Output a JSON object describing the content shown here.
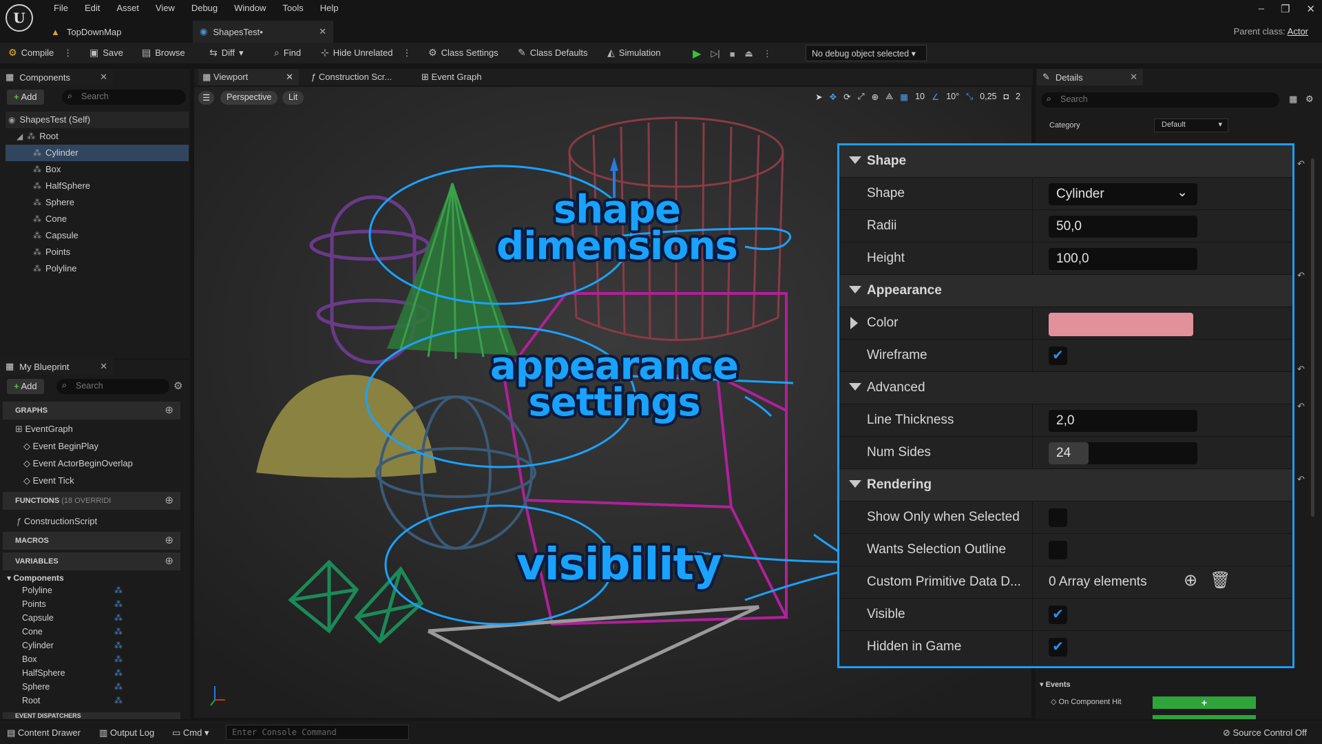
{
  "app": {
    "logo": "U"
  },
  "menu": [
    "File",
    "Edit",
    "Asset",
    "View",
    "Debug",
    "Window",
    "Tools",
    "Help"
  ],
  "window_controls": [
    "–",
    "❐",
    "✕"
  ],
  "tabs": [
    {
      "label": "TopDownMap"
    },
    {
      "label": "ShapesTest•"
    }
  ],
  "parent_class": {
    "label": "Parent class:",
    "value": "Actor"
  },
  "toolbar": {
    "compile": "Compile",
    "save": "Save",
    "browse": "Browse",
    "diff": "Diff",
    "find": "Find",
    "hide_unrelated": "Hide Unrelated",
    "class_settings": "Class Settings",
    "class_defaults": "Class Defaults",
    "simulation": "Simulation",
    "debug_object": "No debug object selected"
  },
  "components_panel": {
    "title": "Components",
    "add": "Add",
    "search_placeholder": "Search",
    "items": [
      {
        "label": "ShapesTest (Self)"
      },
      {
        "label": "Root"
      },
      {
        "label": "Cylinder"
      },
      {
        "label": "Box"
      },
      {
        "label": "HalfSphere"
      },
      {
        "label": "Sphere"
      },
      {
        "label": "Cone"
      },
      {
        "label": "Capsule"
      },
      {
        "label": "Points"
      },
      {
        "label": "Polyline"
      }
    ],
    "selected": "Cylinder"
  },
  "blueprint_panel": {
    "title": "My Blueprint",
    "add": "Add",
    "search_placeholder": "Search",
    "graphs": "GRAPHS",
    "event_graph": "EventGraph",
    "events": [
      "Event BeginPlay",
      "Event ActorBeginOverlap",
      "Event Tick"
    ],
    "functions": "FUNCTIONS",
    "functions_note": "(18 OVERRIDI",
    "construction_script": "ConstructionScript",
    "macros": "MACROS",
    "variables": "VARIABLES",
    "components_group": "Components",
    "variables_list": [
      "Polyline",
      "Points",
      "Capsule",
      "Cone",
      "Cylinder",
      "Box",
      "HalfSphere",
      "Sphere",
      "Root"
    ],
    "event_dispatchers": "EVENT DISPATCHERS"
  },
  "viewport_tabs": [
    {
      "label": "Viewport"
    },
    {
      "label": "Construction Scr..."
    },
    {
      "label": "Event Graph"
    }
  ],
  "viewport": {
    "perspective": "Perspective",
    "lit": "Lit",
    "grid_snap": "10",
    "rot_snap": "10°",
    "scale_snap": "0,25",
    "cam_speed": "2"
  },
  "details": {
    "title": "Details",
    "search_placeholder": "Search",
    "category_label": "Category",
    "category_value": "Default",
    "events_label": "Events",
    "on_component_hit": "On Component Hit",
    "add_glyph": "+"
  },
  "overlay": {
    "shape_header": "Shape",
    "shape_label": "Shape",
    "shape_value": "Cylinder",
    "radii_label": "Radii",
    "radii_value": "50,0",
    "height_label": "Height",
    "height_value": "100,0",
    "appearance_header": "Appearance",
    "color_label": "Color",
    "color_value": "#e2919b",
    "wireframe_label": "Wireframe",
    "wireframe": true,
    "advanced_header": "Advanced",
    "line_thickness_label": "Line Thickness",
    "line_thickness_value": "2,0",
    "num_sides_label": "Num Sides",
    "num_sides_value": "24",
    "rendering_header": "Rendering",
    "show_only_selected_label": "Show Only when Selected",
    "show_only_selected": false,
    "wants_outline_label": "Wants Selection Outline",
    "wants_outline": false,
    "custom_primitive_label": "Custom Primitive Data D...",
    "custom_primitive_value": "0 Array elements",
    "visible_label": "Visible",
    "visible": true,
    "hidden_label": "Hidden in Game",
    "hidden_in_game": true
  },
  "annotations": {
    "shape_dimensions_l1": "shape",
    "shape_dimensions_l2": "dimensions",
    "appearance_l1": "appearance",
    "appearance_l2": "settings",
    "visibility": "visibility"
  },
  "statusbar": {
    "content_drawer": "Content Drawer",
    "output_log": "Output Log",
    "cmd": "Cmd",
    "console_placeholder": "Enter Console Command",
    "source_control": "Source Control Off"
  },
  "colors": {
    "accent_blue": "#1d9ef5",
    "selection": "#30465f",
    "green": "#36c436",
    "swatch": "#e2919b"
  }
}
